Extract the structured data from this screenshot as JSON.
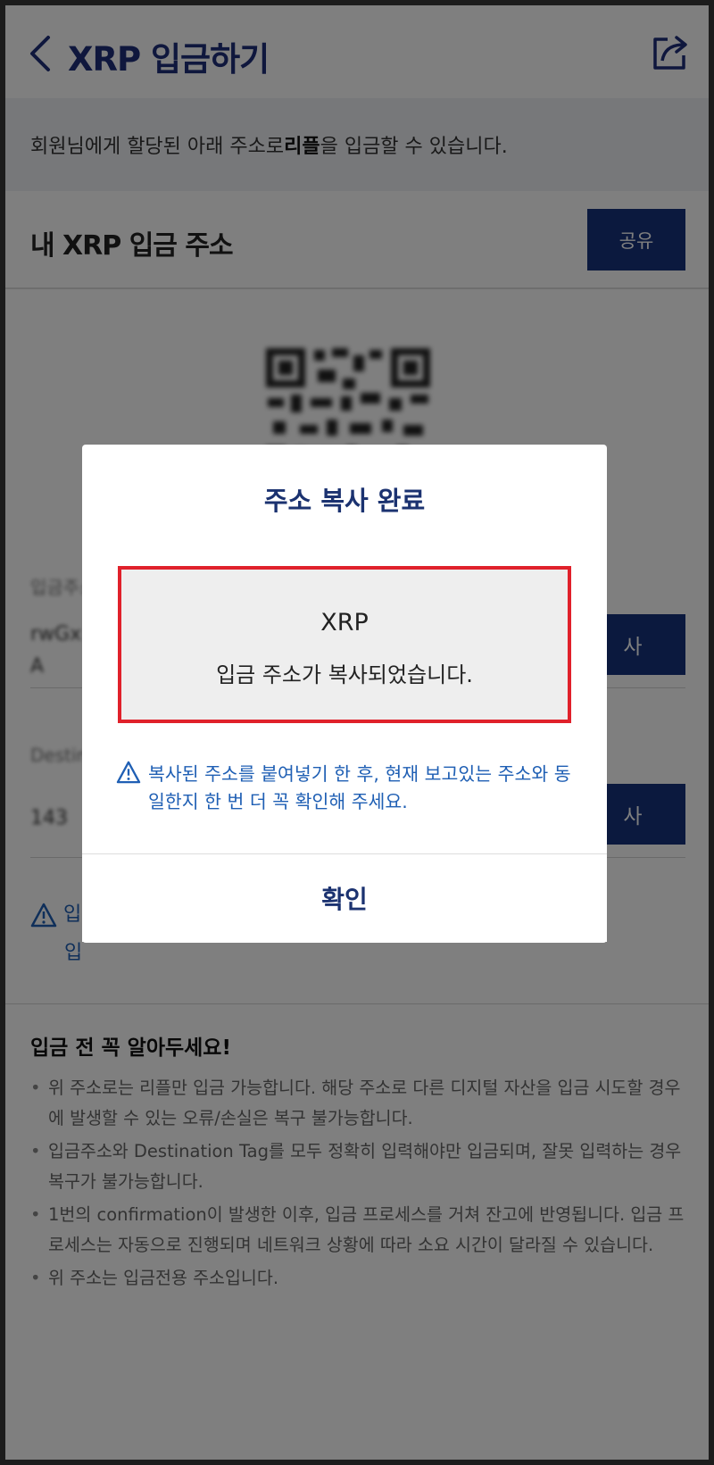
{
  "header": {
    "title": "XRP 입금하기"
  },
  "notice": {
    "prefix": "회원님에게 할당된 아래 주소로 ",
    "coin_name": "리플",
    "suffix": "을 입금할 수 있습니다."
  },
  "address_section": {
    "title": "내 XRP 입금 주소",
    "share_label": "공유",
    "copy_label_1": "사",
    "copy_label_2": "사"
  },
  "warning_under": {
    "line1": "입",
    "line2": "입"
  },
  "guide": {
    "title": "입금 전 꼭 알아두세요!",
    "items": [
      "위 주소로는 리플만 입금 가능합니다. 해당 주소로 다른 디지털 자산을 입금 시도할 경우에 발생할 수 있는 오류/손실은 복구 불가능합니다.",
      "입금주소와 Destination Tag를 모두 정확히 입력해야만 입금되며, 잘못 입력하는 경우 복구가 불가능합니다.",
      "1번의 confirmation이 발생한 이후, 입금 프로세스를 거쳐 잔고에 반영됩니다. 입금 프로세스는 자동으로 진행되며 네트워크 상황에 따라 소요 시간이 달라질 수 있습니다.",
      "위 주소는 입금전용 주소입니다."
    ]
  },
  "modal": {
    "title": "주소 복사 완료",
    "coin": "XRP",
    "message": "입금 주소가 복사되었습니다.",
    "warning": "복사된 주소를 붙여넣기 한 후, 현재 보고있는 주소와 동일한지 한 번 더 꼭 확인해 주세요.",
    "confirm_label": "확인"
  },
  "colors": {
    "brand": "#16337d",
    "title_blue": "#1b3270",
    "warn_blue": "#1f5fb4",
    "highlight_red": "#e0212b"
  },
  "icons": [
    "back-chevron-icon",
    "share-export-icon",
    "qr-code-icon",
    "warning-triangle-icon"
  ]
}
